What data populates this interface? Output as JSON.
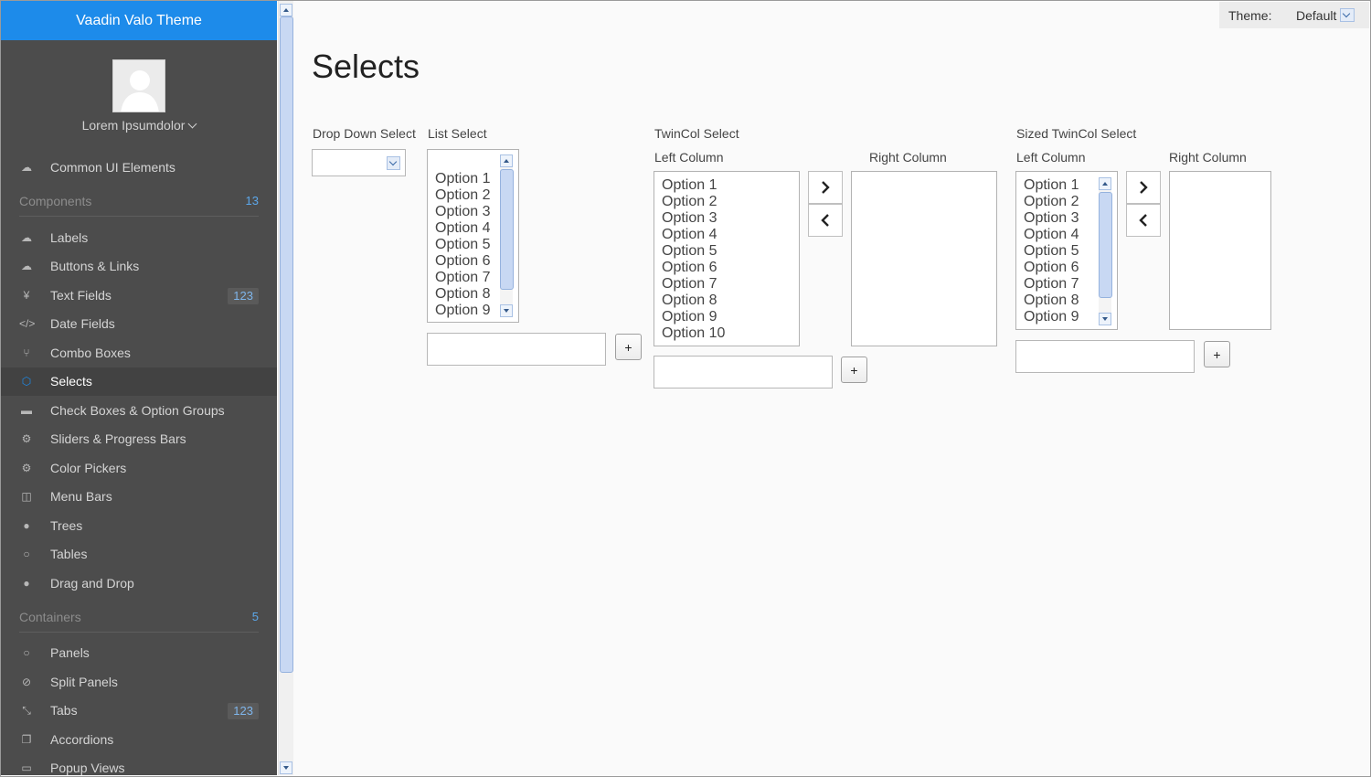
{
  "sidebar": {
    "title": "Vaadin Valo Theme",
    "user_name": "Lorem Ipsumdolor",
    "items_top": [
      {
        "label": "Common UI Elements",
        "icon": "cloud-icon"
      }
    ],
    "components": {
      "label": "Components",
      "count": "13",
      "items": [
        {
          "label": "Labels",
          "icon": "cloud-upload-icon"
        },
        {
          "label": "Buttons & Links",
          "icon": "cloud-upload-icon"
        },
        {
          "label": "Text Fields",
          "icon": "yen-icon",
          "badge": "123"
        },
        {
          "label": "Date Fields",
          "icon": "code-icon"
        },
        {
          "label": "Combo Boxes",
          "icon": "branch-icon"
        },
        {
          "label": "Selects",
          "icon": "cube-icon",
          "selected": true
        },
        {
          "label": "Check Boxes & Option Groups",
          "icon": "keyboard-icon"
        },
        {
          "label": "Sliders & Progress Bars",
          "icon": "cog-icon"
        },
        {
          "label": "Color Pickers",
          "icon": "cogs-icon"
        },
        {
          "label": "Menu Bars",
          "icon": "columns-icon"
        },
        {
          "label": "Trees",
          "icon": "comment-icon"
        },
        {
          "label": "Tables",
          "icon": "comment-outline-icon"
        },
        {
          "label": "Drag and Drop",
          "icon": "comments-icon"
        }
      ]
    },
    "containers": {
      "label": "Containers",
      "count": "5",
      "items": [
        {
          "label": "Panels",
          "icon": "comments-outline-icon"
        },
        {
          "label": "Split Panels",
          "icon": "compass-icon"
        },
        {
          "label": "Tabs",
          "icon": "compress-icon",
          "badge": "123"
        },
        {
          "label": "Accordions",
          "icon": "copy-icon"
        },
        {
          "label": "Popup Views",
          "icon": "credit-card-icon"
        }
      ]
    }
  },
  "theme": {
    "label": "Theme:",
    "value": "Default"
  },
  "page_title": "Selects",
  "dropdown_select": {
    "caption": "Drop Down Select"
  },
  "list_select": {
    "caption": "List Select",
    "options": [
      "Option 1",
      "Option 2",
      "Option 3",
      "Option 4",
      "Option 5",
      "Option 6",
      "Option 7",
      "Option 8",
      "Option 9"
    ],
    "add_button": "+"
  },
  "twincol_select": {
    "caption": "TwinCol Select",
    "left_caption": "Left Column",
    "right_caption": "Right Column",
    "options": [
      "Option 1",
      "Option 2",
      "Option 3",
      "Option 4",
      "Option 5",
      "Option 6",
      "Option 7",
      "Option 8",
      "Option 9",
      "Option 10"
    ],
    "add_button": "+"
  },
  "sized_twincol_select": {
    "caption": "Sized TwinCol Select",
    "left_caption": "Left Column",
    "right_caption": "Right Column",
    "options": [
      "Option 1",
      "Option 2",
      "Option 3",
      "Option 4",
      "Option 5",
      "Option 6",
      "Option 7",
      "Option 8",
      "Option 9"
    ],
    "add_button": "+"
  },
  "colors": {
    "header_blue": "#1d8bea",
    "sidebar_bg": "#4c4c4c",
    "badge_text": "#7fb6ec"
  }
}
